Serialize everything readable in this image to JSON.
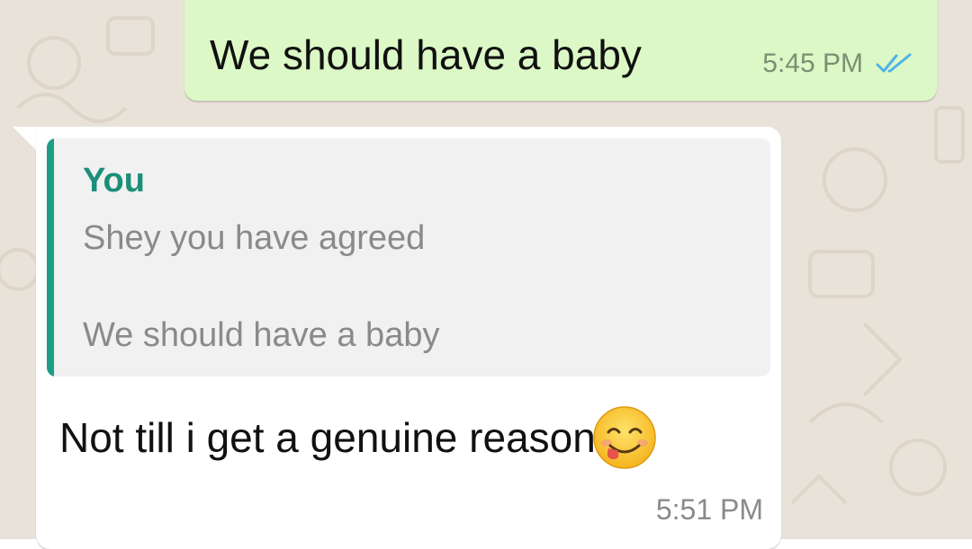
{
  "conversation": {
    "outgoing_message": {
      "text": "We should have a baby",
      "time": "5:45 PM",
      "status_icon": "double-check-icon"
    },
    "incoming_message": {
      "quoted": {
        "author": "You",
        "line1": "Shey you have agreed",
        "line2": "We should have a baby"
      },
      "text": "Not till i get a genuine reason",
      "emoji": "smiling-face-with-tongue-icon",
      "time": "5:51 PM"
    }
  },
  "colors": {
    "outgoing_bubble": "#dcf8c6",
    "incoming_bubble": "#ffffff",
    "chat_background": "#e9e2d8",
    "quote_accent": "#1b9e85",
    "read_ticks": "#4fb3e8"
  }
}
